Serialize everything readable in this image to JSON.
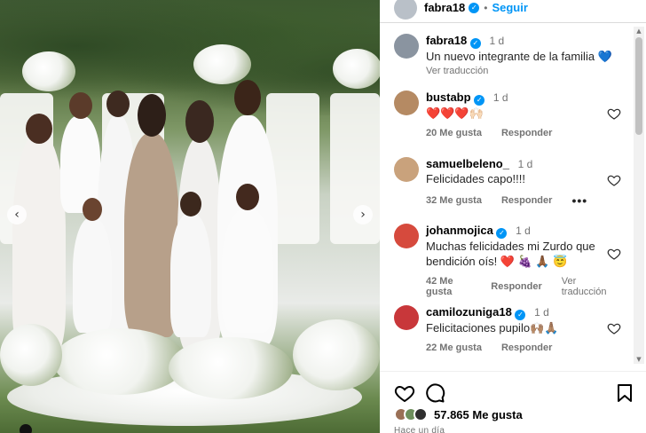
{
  "post": {
    "author": "fabra18",
    "follow_label": "Seguir",
    "separator": "•"
  },
  "comments": [
    {
      "username": "fabra18",
      "verified": true,
      "time": "1 d",
      "text": "Un nuevo integrante de la familia 💙",
      "translate_label": "Ver traducción",
      "avatar_color": "#8a94a0"
    },
    {
      "username": "bustabp",
      "verified": true,
      "time": "1 d",
      "text": "❤️❤️❤️🙌🏻",
      "likes": "20 Me gusta",
      "reply_label": "Responder",
      "avatar_color": "#b58a63"
    },
    {
      "username": "samuelbeleno_",
      "verified": false,
      "time": "1 d",
      "text": "Felicidades capo!!!!",
      "likes": "32 Me gusta",
      "reply_label": "Responder",
      "more_label": "•••",
      "avatar_color": "#c9a27c"
    },
    {
      "username": "johanmojica",
      "verified": true,
      "time": "1 d",
      "text": "Muchas felicidades mi Zurdo que bendición oís! ❤️ 🍇 🙏🏾 😇",
      "likes": "42 Me gusta",
      "reply_label": "Responder",
      "translate_label": "Ver traducción",
      "avatar_color": "#d64a3d"
    },
    {
      "username": "camilozuniga18",
      "verified": true,
      "time": "1 d",
      "text": "Felicitaciones pupilo🙌🏽🙏🏽",
      "likes": "22 Me gusta",
      "reply_label": "Responder",
      "avatar_color": "#c8373a"
    }
  ],
  "actions": {
    "likes_count": "57.865 Me gusta",
    "posted_ago": "Hace un día"
  },
  "colors": {
    "accent": "#0095f6",
    "muted": "#737373"
  }
}
